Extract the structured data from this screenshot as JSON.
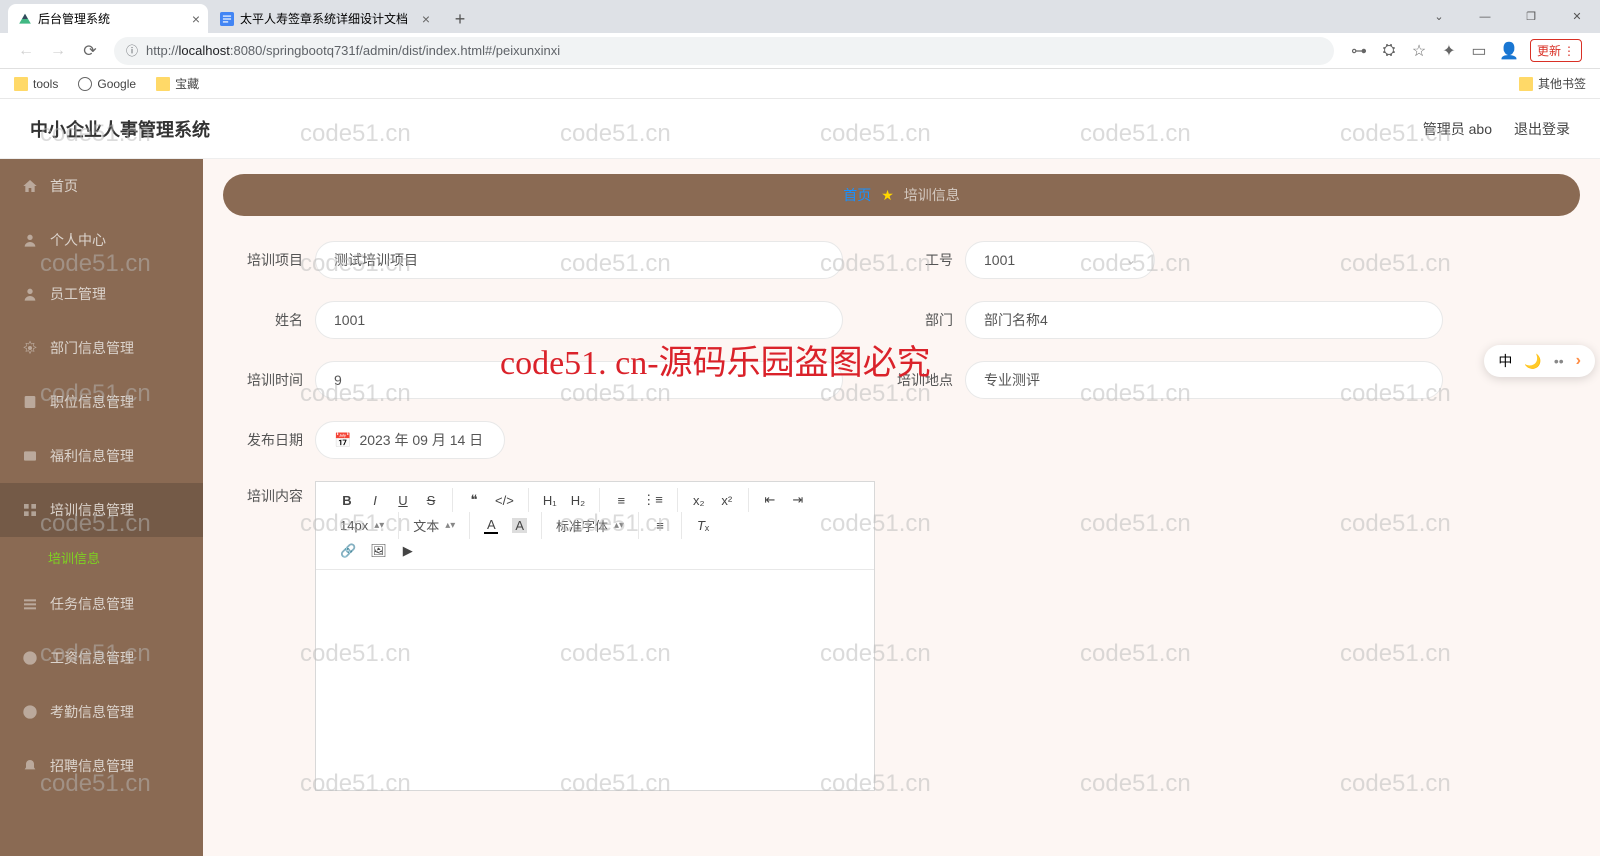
{
  "browser": {
    "tabs": [
      {
        "title": "后台管理系统",
        "active": true
      },
      {
        "title": "太平人寿签章系统详细设计文档",
        "active": false
      }
    ],
    "url_parts": {
      "prefix": "http://",
      "host": "localhost",
      "path": ":8080/springbootq731f/admin/dist/index.html#/peixunxinxi"
    },
    "update_label": "更新",
    "bookmarks": {
      "tools": "tools",
      "google": "Google",
      "treasure": "宝藏",
      "other": "其他书签"
    }
  },
  "header": {
    "title": "中小企业人事管理系统",
    "user": "管理员 abo",
    "logout": "退出登录"
  },
  "sidebar": {
    "items": [
      {
        "label": "首页",
        "icon": "home"
      },
      {
        "label": "个人中心",
        "icon": "user"
      },
      {
        "label": "员工管理",
        "icon": "user"
      },
      {
        "label": "部门信息管理",
        "icon": "gear"
      },
      {
        "label": "职位信息管理",
        "icon": "doc"
      },
      {
        "label": "福利信息管理",
        "icon": "mail"
      },
      {
        "label": "培训信息管理",
        "icon": "grid",
        "active": true
      },
      {
        "label": "任务信息管理",
        "icon": "list"
      },
      {
        "label": "工资信息管理",
        "icon": "money"
      },
      {
        "label": "考勤信息管理",
        "icon": "clock"
      },
      {
        "label": "招聘信息管理",
        "icon": "bell"
      }
    ],
    "sub": "培训信息"
  },
  "breadcrumb": {
    "home": "首页",
    "current": "培训信息"
  },
  "form": {
    "project": {
      "label": "培训项目",
      "value": "测试培训项目"
    },
    "emp_no": {
      "label": "工号",
      "value": "1001"
    },
    "name": {
      "label": "姓名",
      "value": "1001"
    },
    "dept": {
      "label": "部门",
      "value": "部门名称4"
    },
    "time": {
      "label": "培训时间",
      "value": "9"
    },
    "loc": {
      "label": "培训地点",
      "value": "专业测评"
    },
    "date": {
      "label": "发布日期",
      "value": "2023 年 09 月 14 日"
    },
    "content": {
      "label": "培训内容"
    }
  },
  "editor": {
    "font_size": "14px",
    "font_style": "文本",
    "font_family": "标准字体"
  },
  "watermark_text": "code51.cn",
  "red_overlay": "code51. cn-源码乐园盗图必究",
  "ime": {
    "ch": "中"
  }
}
